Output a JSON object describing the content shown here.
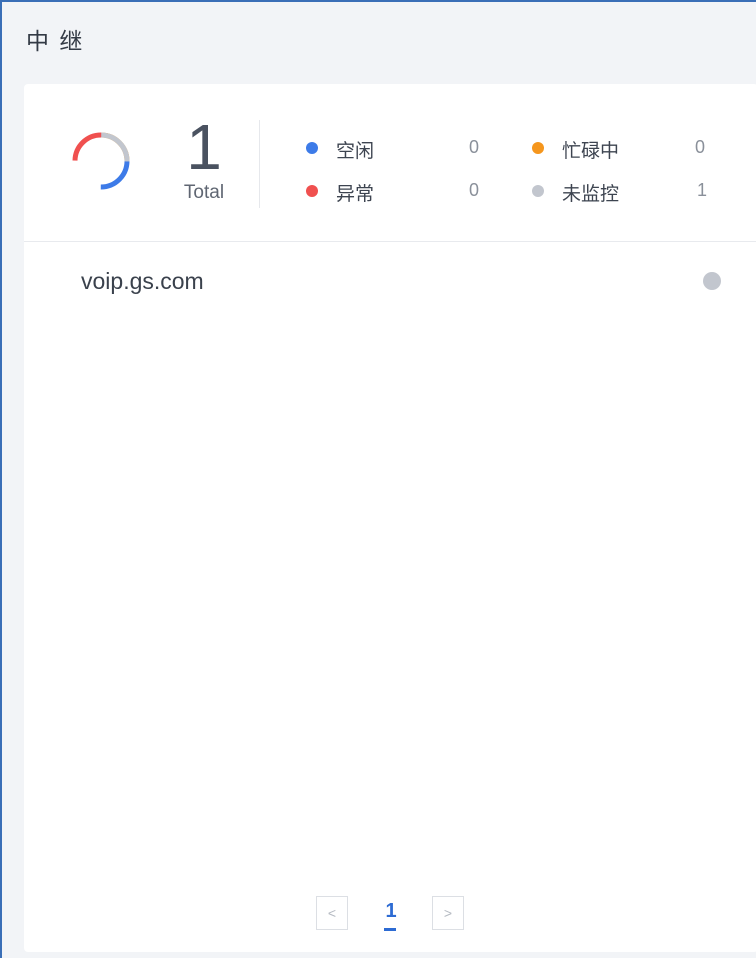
{
  "panel": {
    "title": "中 继"
  },
  "summary": {
    "total_value": "1",
    "total_label": "Total",
    "legend": [
      {
        "label": "空闲",
        "count": "0",
        "color": "#3d7be8"
      },
      {
        "label": "忙碌中",
        "count": "0",
        "color": "#f5961d"
      },
      {
        "label": "异常",
        "count": "0",
        "color": "#f0504f"
      },
      {
        "label": "未监控",
        "count": "1",
        "color": "#c2c6ce"
      }
    ]
  },
  "trunks": [
    {
      "name": "voip.gs.com",
      "status_color": "#c2c6ce"
    }
  ],
  "pagination": {
    "prev_icon": "chevron-left-icon",
    "next_icon": "chevron-right-icon",
    "prev_glyph": "<",
    "next_glyph": ">",
    "current_page": "1"
  }
}
